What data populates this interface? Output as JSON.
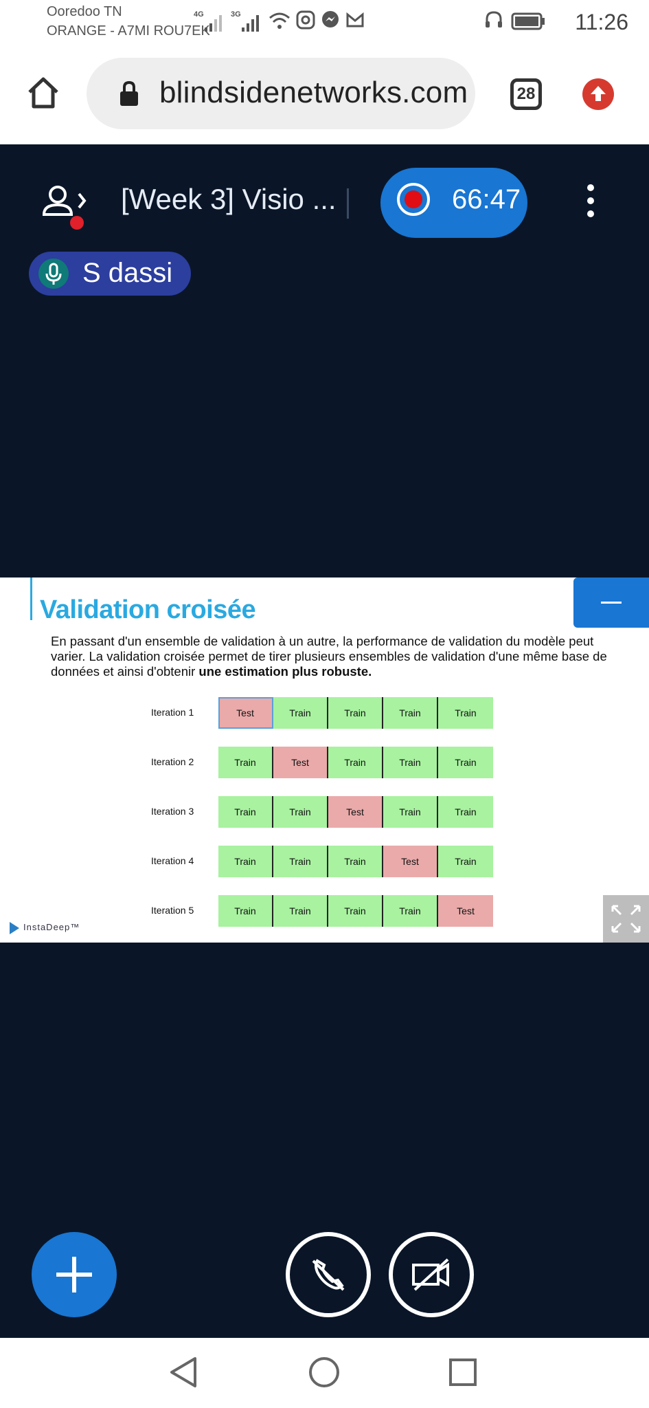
{
  "status_bar": {
    "carrier_1": "Ooredoo TN",
    "carrier_2": "ORANGE - A7MI ROU7EK",
    "signal_1_label": "4G",
    "signal_2_label": "3G",
    "time": "11:26",
    "icons": [
      "signal-icon",
      "wifi-icon",
      "instagram-icon",
      "messenger-icon",
      "gmail-icon",
      "headphones-icon",
      "battery-icon"
    ]
  },
  "browser": {
    "url": "blindsidenetworks.com",
    "tab_count": "28",
    "icons": [
      "home-icon",
      "lock-icon",
      "tabs-icon",
      "upload-icon"
    ]
  },
  "meeting": {
    "title": "[Week 3] Visio ...",
    "recording_time": "66:47",
    "talker_name": "S dassi"
  },
  "slide": {
    "title": "Validation croisée",
    "body_text": "En passant d'un ensemble de validation à un autre, la performance de validation du modèle peut varier. La validation croisée permet de tirer plusieurs ensembles de validation d'une même base de données et ainsi d'obtenir ",
    "body_bold": "une estimation plus robuste.",
    "logo_text": "InstaDeep™",
    "iterations": [
      {
        "label": "Iteration 1",
        "cells": [
          "Test",
          "Train",
          "Train",
          "Train",
          "Train"
        ]
      },
      {
        "label": "Iteration 2",
        "cells": [
          "Train",
          "Test",
          "Train",
          "Train",
          "Train"
        ]
      },
      {
        "label": "Iteration 3",
        "cells": [
          "Train",
          "Train",
          "Test",
          "Train",
          "Train"
        ]
      },
      {
        "label": "Iteration 4",
        "cells": [
          "Train",
          "Train",
          "Train",
          "Test",
          "Train"
        ]
      },
      {
        "label": "Iteration 5",
        "cells": [
          "Train",
          "Train",
          "Train",
          "Train",
          "Test"
        ]
      }
    ]
  },
  "controls": {
    "icons": [
      "plus-icon",
      "hangup-icon",
      "camera-off-icon"
    ]
  },
  "nav": {
    "icons": [
      "back-icon",
      "home-circle-icon",
      "recents-icon"
    ]
  },
  "colors": {
    "background": "#0a1628",
    "accent_blue": "#1976d2",
    "record_red": "#e00d14",
    "title_cyan": "#2aa9e0",
    "train_green": "#a8f2a0",
    "test_red": "#eaaaaa"
  }
}
